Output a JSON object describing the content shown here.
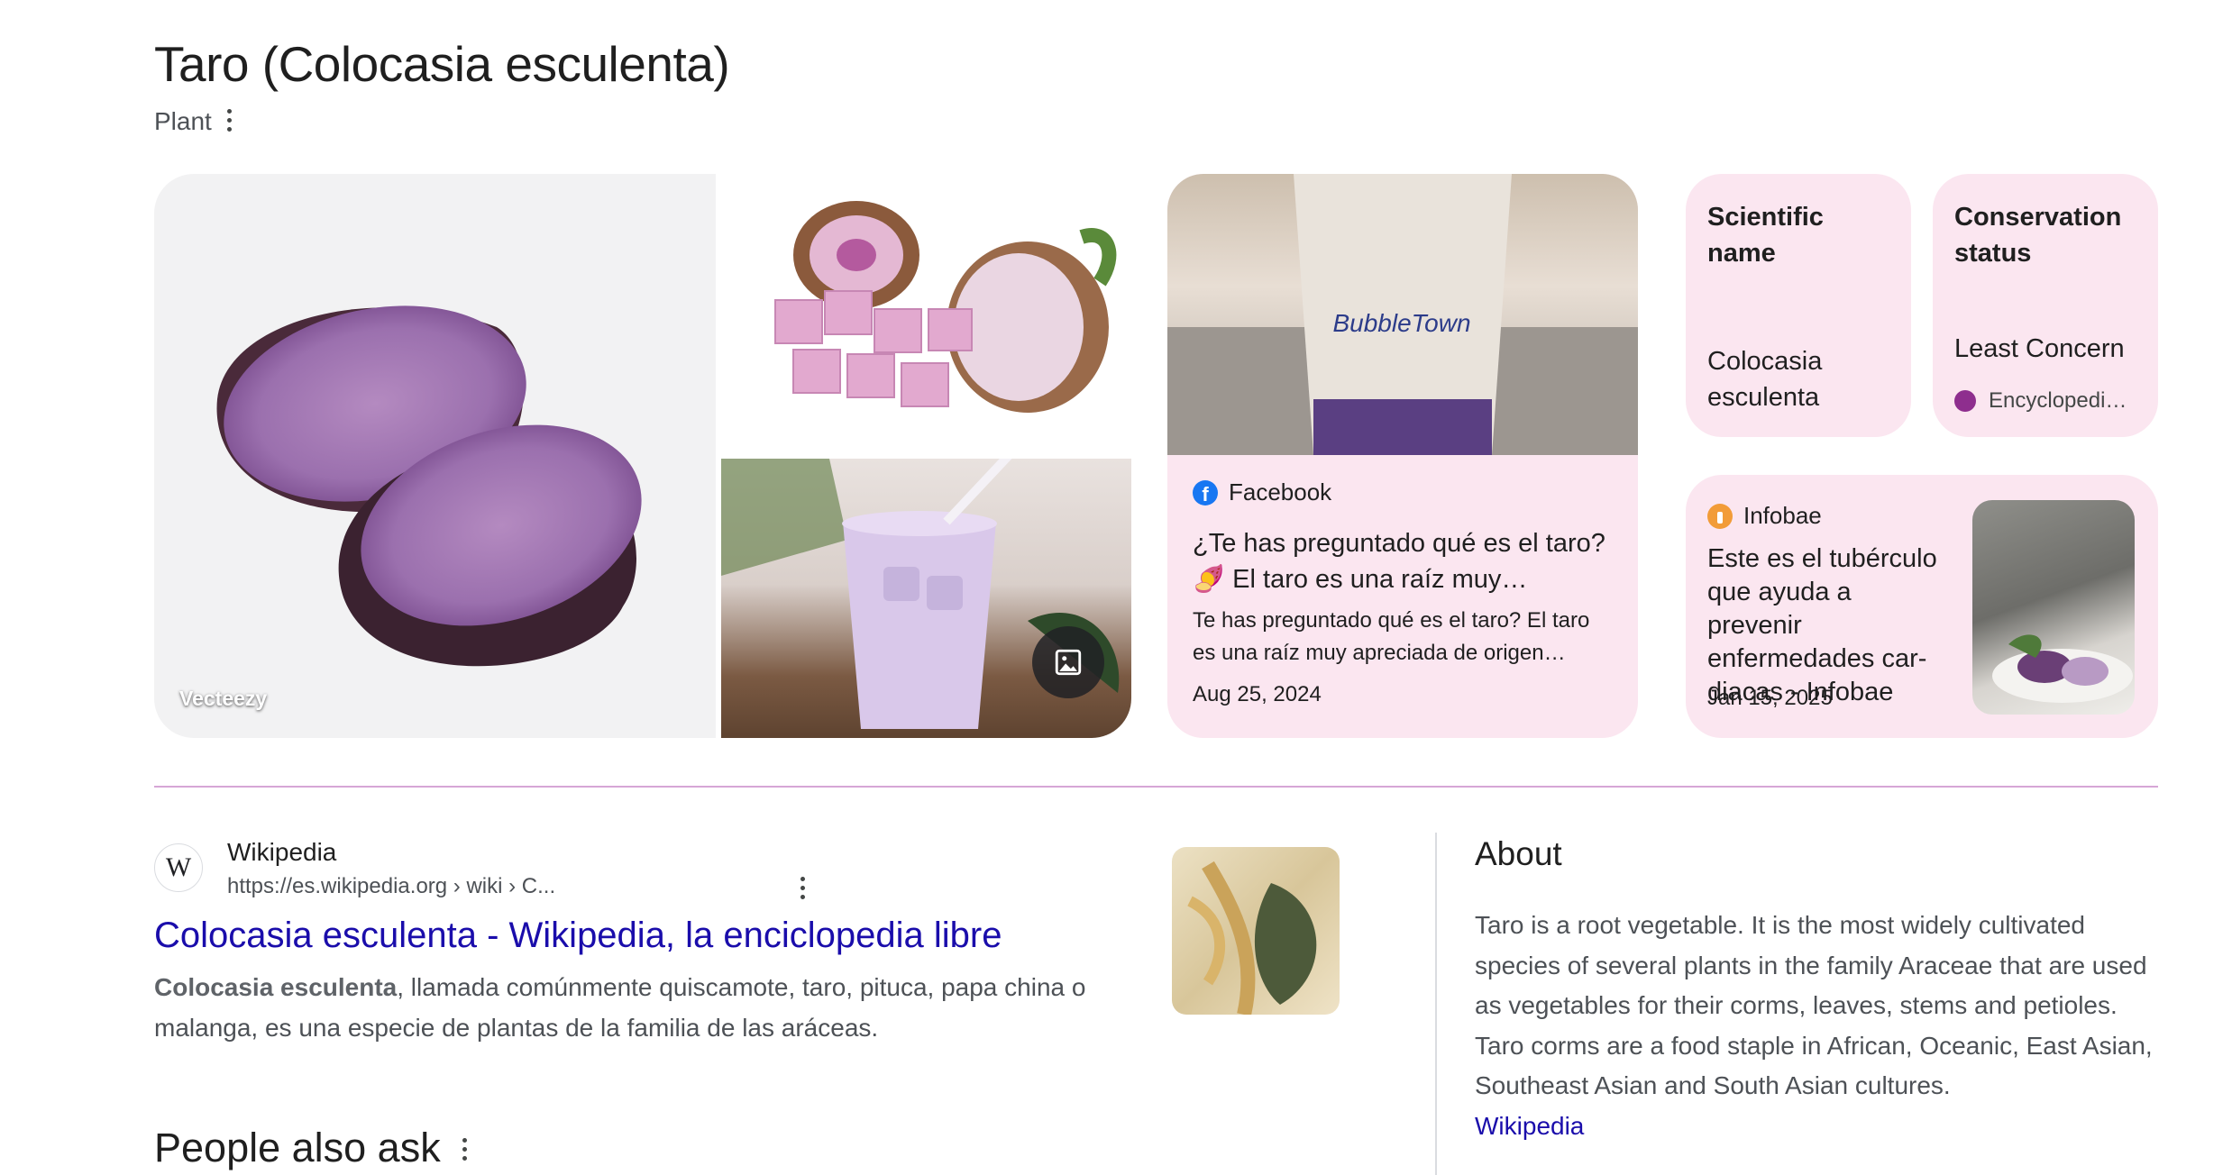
{
  "header": {
    "title": "Taro (Colocasia esculenta)",
    "subtitle": "Plant"
  },
  "gallery": {
    "credit": "Vecteezy",
    "cup_brand": "BubbleTown"
  },
  "facebook_card": {
    "source": "Facebook",
    "headline": "¿Te has preguntado qué es el taro? 🍠 El taro es una raíz muy…",
    "snippet": "Te has preguntado qué es el taro? El taro es una raíz muy apreciada de origen…",
    "date": "Aug 25, 2024"
  },
  "facts": [
    {
      "label": "Scientific name",
      "value": "Colocasia esculenta"
    },
    {
      "label": "Conservation status",
      "value": "Least Concern",
      "source": "Encyclopedi…"
    }
  ],
  "infobae_card": {
    "source": "Infobae",
    "headline": "Este es el tubérculo que ayuda a prevenir enfermedades car-diacas - Infobae",
    "date": "Jan 15, 2025"
  },
  "result": {
    "site": "Wikipedia",
    "logo_letter": "W",
    "url": "https://es.wikipedia.org › wiki › C...",
    "title": "Colocasia esculenta - Wikipedia, la enciclopedia libre",
    "snippet_bold": "Colocasia esculenta",
    "snippet_rest": ", llamada comúnmente quiscamote, taro, pituca, papa china o malanga, es una especie de plantas de la familia de las aráceas."
  },
  "about": {
    "heading": "About",
    "text": "Taro is a root vegetable. It is the most widely cultivated species of several plants in the family Araceae that are used as vegetables for their corms, leaves, stems and petioles. Taro corms are a food staple in African, Oceanic, East Asian, Southeast Asian and South Asian cultures.",
    "link": "Wikipedia"
  },
  "people_also_ask": {
    "heading": "People also ask"
  },
  "colors": {
    "card_bg": "#fbe6f0",
    "link": "#1a0dab",
    "divider": "#d6a6d6",
    "facebook": "#1877f2",
    "infobae": "#f29c38"
  },
  "icons": [
    "kebab-icon",
    "image-icon",
    "facebook-icon",
    "globe-icon",
    "infobae-icon",
    "wikipedia-icon"
  ]
}
